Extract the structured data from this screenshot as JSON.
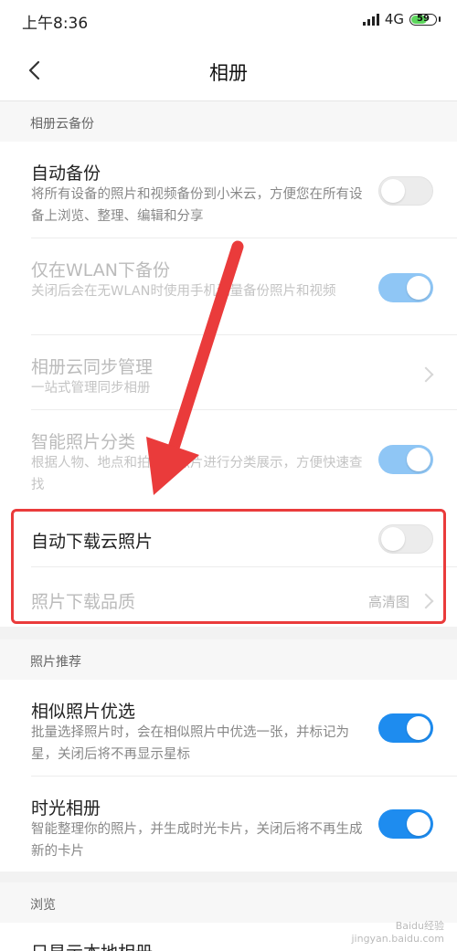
{
  "status_bar": {
    "time": "上午8:36",
    "network": "4G",
    "battery": "59",
    "battery_level": 0.59
  },
  "header": {
    "title": "相册",
    "back_icon": "chevron-left-icon"
  },
  "sections": {
    "cloud_backup": {
      "header": "相册云备份",
      "auto_backup": {
        "title": "自动备份",
        "desc": "将所有设备的照片和视频备份到小米云，方便您在所有设备上浏览、整理、编辑和分享",
        "toggle": "off"
      },
      "wlan_only": {
        "title": "仅在WLAN下备份",
        "desc": "关闭后会在无WLAN时使用手机流量备份照片和视频",
        "toggle": "on"
      },
      "sync_manage": {
        "title": "相册云同步管理",
        "desc": "一站式管理同步相册"
      },
      "smart_classify": {
        "title": "智能照片分类",
        "desc": "根据人物、地点和拍摄时照片进行分类展示，方便快速查找",
        "toggle": "on"
      },
      "auto_download": {
        "title": "自动下载云照片",
        "toggle": "off"
      },
      "download_quality": {
        "title": "照片下载品质",
        "value": "高清图"
      }
    },
    "recommend": {
      "header": "照片推荐",
      "similar": {
        "title": "相似照片优选",
        "desc": "批量选择照片时，会在相似照片中优选一张，并标记为星，关闭后将不再显示星标",
        "toggle": "on"
      },
      "timeline": {
        "title": "时光相册",
        "desc": "智能整理你的照片，并生成时光卡片，关闭后将不再生成新的卡片",
        "toggle": "on"
      }
    },
    "browse": {
      "header": "浏览",
      "local_only": {
        "title": "只显示本地相册"
      }
    }
  },
  "colors": {
    "accent": "#1e8cef",
    "annotation_red": "#ea3b3b"
  },
  "watermark": {
    "brand": "Baidu经验",
    "url": "jingyan.baidu.com"
  }
}
